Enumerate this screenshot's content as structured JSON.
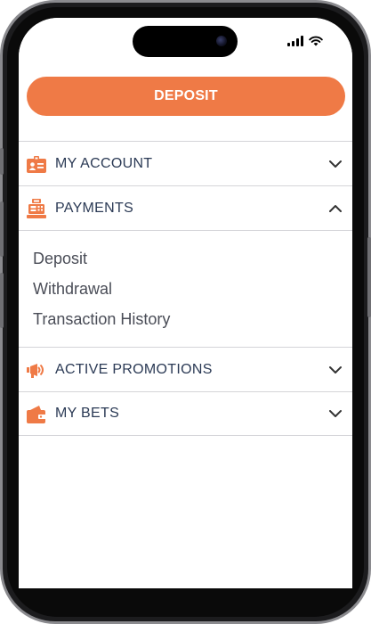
{
  "deposit_button": {
    "label": "DEPOSIT"
  },
  "menu": {
    "items": [
      {
        "label": "MY ACCOUNT",
        "icon": "account-card-icon",
        "expanded": false
      },
      {
        "label": "PAYMENTS",
        "icon": "cash-register-icon",
        "expanded": true,
        "subitems": [
          "Deposit",
          "Withdrawal",
          "Transaction History"
        ]
      },
      {
        "label": "ACTIVE PROMOTIONS",
        "icon": "megaphone-icon",
        "expanded": false
      },
      {
        "label": "MY BETS",
        "icon": "wallet-icon",
        "expanded": false
      }
    ]
  },
  "colors": {
    "accent": "#ef7a46",
    "label": "#2b3a55",
    "divider": "#d4d4d8",
    "subitem": "#4a4d57"
  }
}
